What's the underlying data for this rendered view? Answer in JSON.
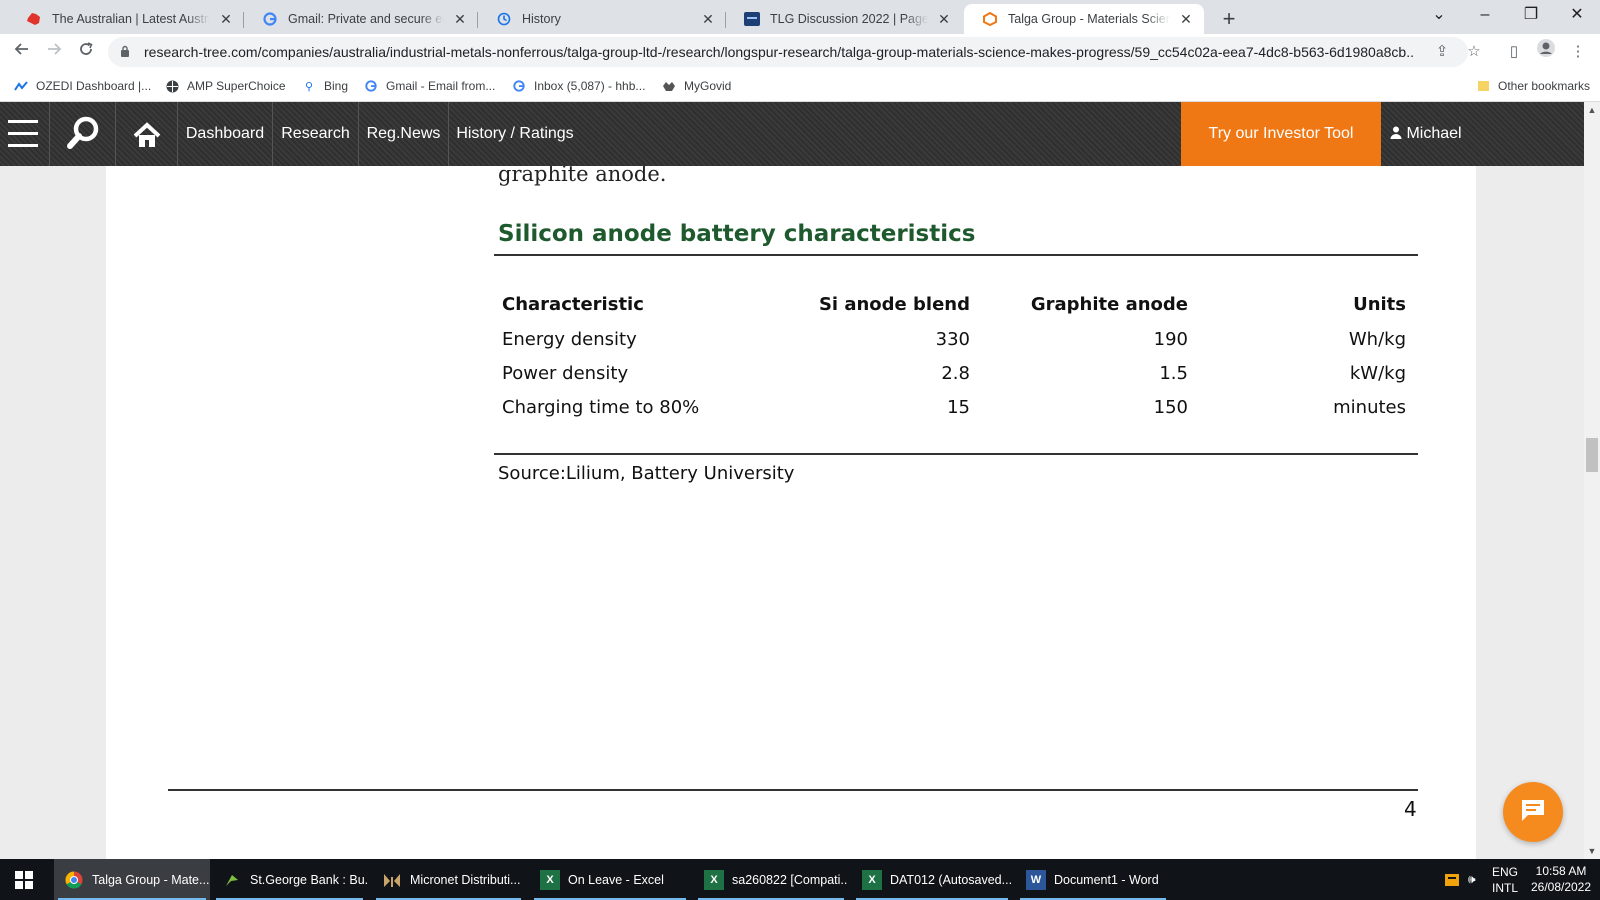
{
  "browser": {
    "tabs": [
      {
        "title": "The Australian | Latest Australian",
        "icon": "australian-logo-icon"
      },
      {
        "title": "Gmail: Private and secure email a",
        "icon": "google-icon"
      },
      {
        "title": "History",
        "icon": "history-icon"
      },
      {
        "title": "TLG Discussion 2022 | Page 21 | T",
        "icon": "hotcopper-icon"
      },
      {
        "title": "Talga Group - Materials Science M",
        "icon": "research-tree-icon",
        "active": true
      }
    ],
    "url": "research-tree.com/companies/australia/industrial-metals-nonferrous/talga-group-ltd-/research/longspur-research/talga-group-materials-science-makes-progress/59_cc54c02a-eea7-4dc8-b563-6d1980a8cb...",
    "bookmarks": [
      {
        "label": "OZEDI Dashboard |...",
        "icon": "ozedi-icon"
      },
      {
        "label": "AMP SuperChoice",
        "icon": "globe-icon"
      },
      {
        "label": "Bing",
        "icon": "bing-search-icon"
      },
      {
        "label": "Gmail - Email from...",
        "icon": "google-icon"
      },
      {
        "label": "Inbox (5,087) - hhb...",
        "icon": "google-icon"
      },
      {
        "label": "MyGovid",
        "icon": "coat-of-arms-icon"
      }
    ],
    "other_bookmarks": "Other bookmarks"
  },
  "site_nav": {
    "links": [
      "Dashboard",
      "Research",
      "Reg.News",
      "History / Ratings"
    ],
    "cta": "Try our Investor Tool",
    "user": "Michael"
  },
  "document": {
    "prev_text": "graphite anode.",
    "section_title": "Silicon anode battery characteristics",
    "table": {
      "headers": [
        "Characteristic",
        "Si anode blend",
        "Graphite anode",
        "Units"
      ],
      "rows": [
        [
          "Energy density",
          "330",
          "190",
          "Wh/kg"
        ],
        [
          "Power density",
          "2.8",
          "1.5",
          "kW/kg"
        ],
        [
          "Charging time to 80%",
          "15",
          "150",
          "minutes"
        ]
      ]
    },
    "source": "Source:Lilium, Battery University",
    "page_number": "4"
  },
  "taskbar": {
    "items": [
      {
        "label": "Talga Group - Mate...",
        "icon": "chrome-icon",
        "active": true
      },
      {
        "label": "St.George Bank : Bu...",
        "icon": "stgeorge-icon"
      },
      {
        "label": "Micronet Distributi...",
        "icon": "micronet-icon"
      },
      {
        "label": "On Leave - Excel",
        "icon": "excel-icon"
      },
      {
        "label": "sa260822  [Compati...",
        "icon": "excel-icon"
      },
      {
        "label": "DAT012 (Autosaved...",
        "icon": "excel-icon"
      },
      {
        "label": "Document1 - Word",
        "icon": "word-icon"
      }
    ],
    "lang": "ENG",
    "layout": "INTL",
    "time": "10:58 AM",
    "date": "26/08/2022"
  },
  "colors": {
    "accent_orange": "#f07814",
    "section_green": "#1e5a2e",
    "nav_dark": "#333333"
  }
}
